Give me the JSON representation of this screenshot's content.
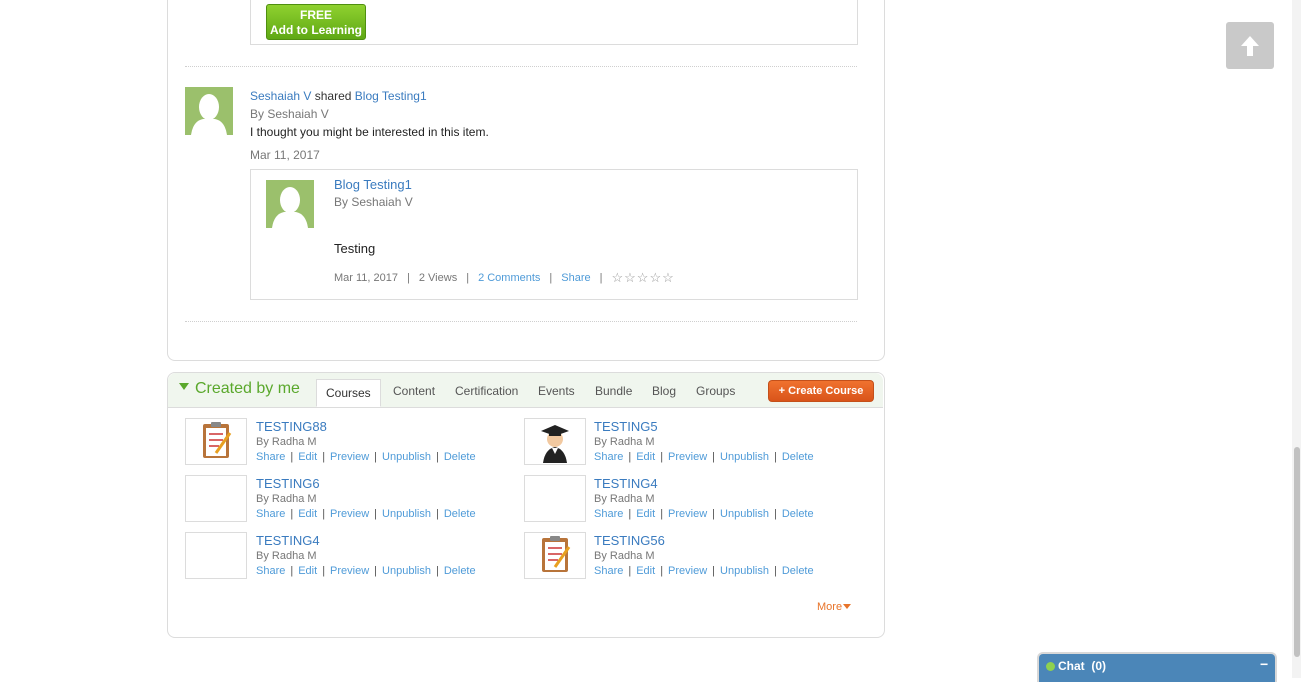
{
  "top_course": {
    "button_line1": "FREE",
    "button_line2": "Add to Learning"
  },
  "activity": {
    "actor": "Seshaiah V",
    "verb": "shared",
    "target": "Blog Testing1",
    "by": "By Seshaiah V",
    "message": "I thought you might be interested in this item.",
    "date": "Mar 11, 2017",
    "item": {
      "title": "Blog Testing1",
      "by": "By Seshaiah V",
      "body": "Testing",
      "date": "Mar 11, 2017",
      "views": "2 Views",
      "comments": "2 Comments",
      "share": "Share",
      "separator": "|",
      "rating_stars": "☆☆☆☆☆"
    }
  },
  "created": {
    "title": "Created by me",
    "tabs": [
      "Courses",
      "Content",
      "Certification",
      "Events",
      "Bundle",
      "Blog",
      "Groups"
    ],
    "active_tab": "Courses",
    "create_button": "+ Create Course",
    "action_labels": [
      "Share",
      "Edit",
      "Preview",
      "Unpublish",
      "Delete"
    ],
    "courses": [
      {
        "title": "TESTING88",
        "by": "By Radha M",
        "thumb": "clipboard-icon"
      },
      {
        "title": "TESTING5",
        "by": "By Radha M",
        "thumb": "graduate-icon"
      },
      {
        "title": "TESTING6",
        "by": "By Radha M",
        "thumb": "empty"
      },
      {
        "title": "TESTING4",
        "by": "By Radha M",
        "thumb": "empty"
      },
      {
        "title": "TESTING4",
        "by": "By Radha M",
        "thumb": "empty"
      },
      {
        "title": "TESTING56",
        "by": "By Radha M",
        "thumb": "clipboard-icon"
      }
    ],
    "more": "More"
  },
  "chat": {
    "label": "Chat",
    "count": "(0)",
    "minimize": "−"
  },
  "colors": {
    "link": "#3a7bbf",
    "accent_green": "#5aa82c",
    "create_orange": "#e06020",
    "chat_blue": "#4b86b8"
  }
}
